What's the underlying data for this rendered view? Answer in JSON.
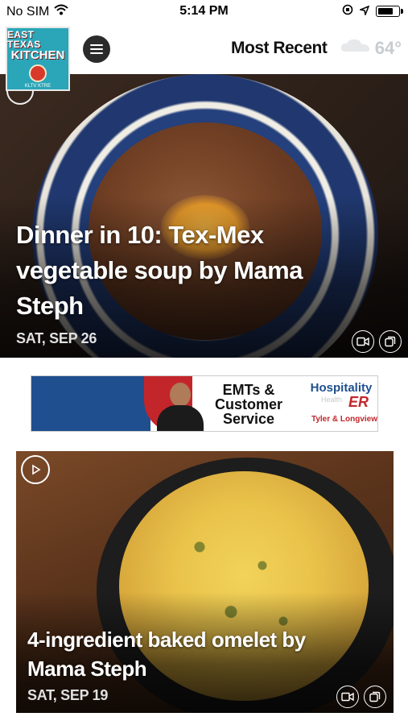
{
  "status_bar": {
    "carrier": "No SIM",
    "time": "5:14 PM"
  },
  "header": {
    "logo_line1": "EAST TEXAS",
    "logo_line2": "KITCHEN",
    "logo_calls": "KLTV  KTRE",
    "section_title": "Most Recent",
    "weather_temp": "64°"
  },
  "articles": [
    {
      "title": "Dinner in 10: Tex-Mex vegetable soup by Mama Steph",
      "date": "SAT, SEP 26"
    },
    {
      "title": "4-ingredient baked omelet by Mama Steph",
      "date": "SAT, SEP 19"
    }
  ],
  "ad": {
    "headline": "EMTs & Customer Service",
    "brand": "Hospitality",
    "brand_sub": "Health",
    "brand_er": "ER",
    "brand_location": "Tyler & Longview"
  },
  "colors": {
    "logo_bg": "#2aa6b8",
    "menu_button": "#2b2b2b",
    "ad_blue": "#1f4f8f",
    "ad_red": "#c2262b"
  }
}
